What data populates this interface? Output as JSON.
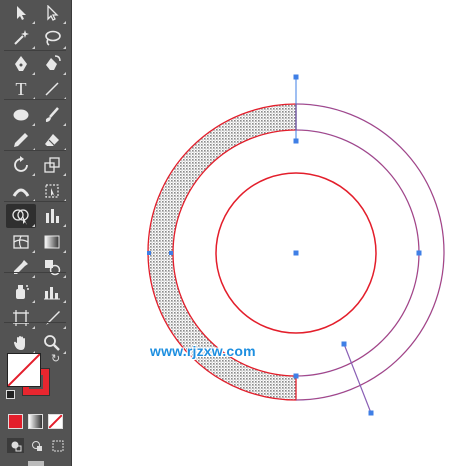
{
  "toolbar": {
    "tools": [
      {
        "name": "selection-tool-icon",
        "glyph": "arrow"
      },
      {
        "name": "direct-selection-tool-icon",
        "glyph": "arrow-hollow"
      },
      {
        "name": "magic-wand-tool-icon",
        "glyph": "wand"
      },
      {
        "name": "lasso-tool-icon",
        "glyph": "lasso"
      },
      {
        "name": "pen-tool-icon",
        "glyph": "pen"
      },
      {
        "name": "curvature-tool-icon",
        "glyph": "pen2"
      },
      {
        "name": "type-tool-icon",
        "glyph": "T"
      },
      {
        "name": "line-segment-tool-icon",
        "glyph": "line"
      },
      {
        "name": "ellipse-tool-icon",
        "glyph": "ellipse"
      },
      {
        "name": "paintbrush-tool-icon",
        "glyph": "brush"
      },
      {
        "name": "pencil-tool-icon",
        "glyph": "pencil"
      },
      {
        "name": "eraser-tool-icon",
        "glyph": "eraser"
      },
      {
        "name": "rotate-tool-icon",
        "glyph": "rotate"
      },
      {
        "name": "scale-tool-icon",
        "glyph": "scale"
      },
      {
        "name": "width-tool-icon",
        "glyph": "width"
      },
      {
        "name": "free-transform-tool-icon",
        "glyph": "freetransform"
      },
      {
        "name": "shape-builder-tool-icon",
        "glyph": "shapebuilder",
        "active": true
      },
      {
        "name": "column-graph-tool-icon",
        "glyph": "graph"
      },
      {
        "name": "mesh-tool-icon",
        "glyph": "mesh"
      },
      {
        "name": "gradient-tool-icon",
        "glyph": "gradient"
      },
      {
        "name": "eyedropper-tool-icon",
        "glyph": "eyedropper"
      },
      {
        "name": "blend-tool-icon",
        "glyph": "blend"
      },
      {
        "name": "symbol-sprayer-tool-icon",
        "glyph": "spray"
      },
      {
        "name": "bar-graph-tool-icon",
        "glyph": "bars"
      },
      {
        "name": "artboard-tool-icon",
        "glyph": "artboard"
      },
      {
        "name": "slice-tool-icon",
        "glyph": "slice"
      },
      {
        "name": "hand-tool-icon",
        "glyph": "hand"
      },
      {
        "name": "zoom-tool-icon",
        "glyph": "zoom"
      }
    ],
    "fill_color": "#ffffff",
    "stroke_color": "#e8262f",
    "modes": [
      "color",
      "gradient",
      "none"
    ],
    "draw_modes": [
      "draw-normal",
      "draw-behind",
      "draw-inside"
    ]
  },
  "canvas": {
    "ring_fill_pattern": "dotted-gray",
    "stroke_red": "#e31e2b",
    "path_purple": "#8a5fb5",
    "anchor_blue": "#3f7fe6"
  },
  "watermark": "www.rjzxw.com"
}
